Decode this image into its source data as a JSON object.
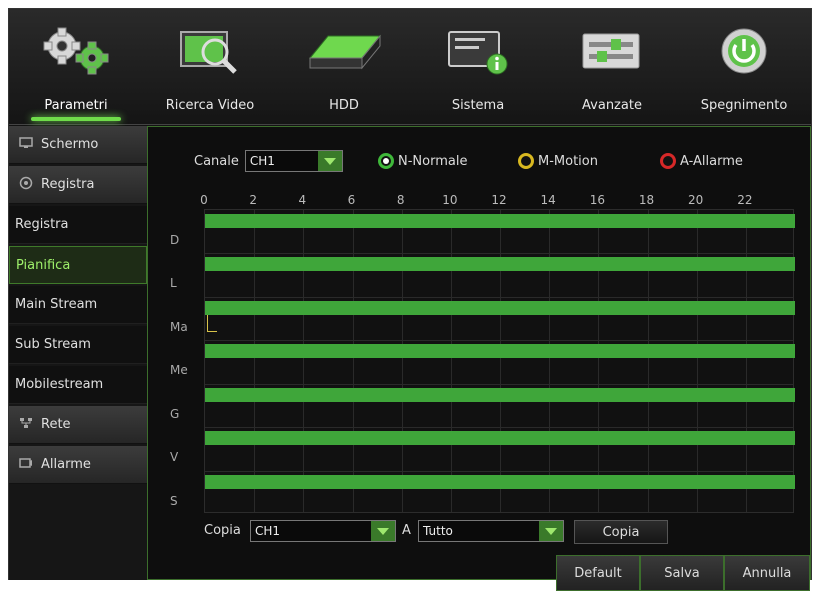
{
  "toolbar": {
    "items": [
      {
        "label": "Parametri",
        "icon": "gears-icon",
        "active": true
      },
      {
        "label": "Ricerca Video",
        "icon": "video-search-icon",
        "active": false
      },
      {
        "label": "HDD",
        "icon": "hdd-icon",
        "active": false
      },
      {
        "label": "Sistema",
        "icon": "system-info-icon",
        "active": false
      },
      {
        "label": "Avanzate",
        "icon": "advanced-settings-icon",
        "active": false
      },
      {
        "label": "Spegnimento",
        "icon": "power-icon",
        "active": false
      }
    ]
  },
  "sidebar": {
    "items": [
      {
        "label": "Schermo",
        "type": "head",
        "icon": "monitor-icon"
      },
      {
        "label": "Registra",
        "type": "head",
        "icon": "record-icon"
      },
      {
        "label": "Registra",
        "type": "sub"
      },
      {
        "label": "Pianifica",
        "type": "sub",
        "selected": true
      },
      {
        "label": "Main Stream",
        "type": "sub"
      },
      {
        "label": "Sub Stream",
        "type": "sub"
      },
      {
        "label": "Mobilestream",
        "type": "sub"
      },
      {
        "label": "Rete",
        "type": "head",
        "icon": "network-icon"
      },
      {
        "label": "Allarme",
        "type": "head",
        "icon": "alarm-icon"
      }
    ]
  },
  "schedule": {
    "channel_label": "Canale",
    "channel_value": "CH1",
    "modes": [
      {
        "label": "N-Normale",
        "color": "#3fb83a",
        "selected": true
      },
      {
        "label": "M-Motion",
        "color": "#d8b820",
        "selected": false
      },
      {
        "label": "A-Allarme",
        "color": "#d62828",
        "selected": false
      }
    ],
    "hour_labels": [
      "0",
      "2",
      "4",
      "6",
      "8",
      "10",
      "12",
      "14",
      "16",
      "18",
      "20",
      "22"
    ],
    "days": [
      "D",
      "L",
      "Ma",
      "Me",
      "G",
      "V",
      "S"
    ],
    "bar_color": "#3fa63a"
  },
  "copy": {
    "label": "Copia",
    "from_value": "CH1",
    "to_label": "A",
    "to_value": "Tutto",
    "button_label": "Copia"
  },
  "buttons": {
    "default_label": "Default",
    "save_label": "Salva",
    "cancel_label": "Annulla"
  }
}
